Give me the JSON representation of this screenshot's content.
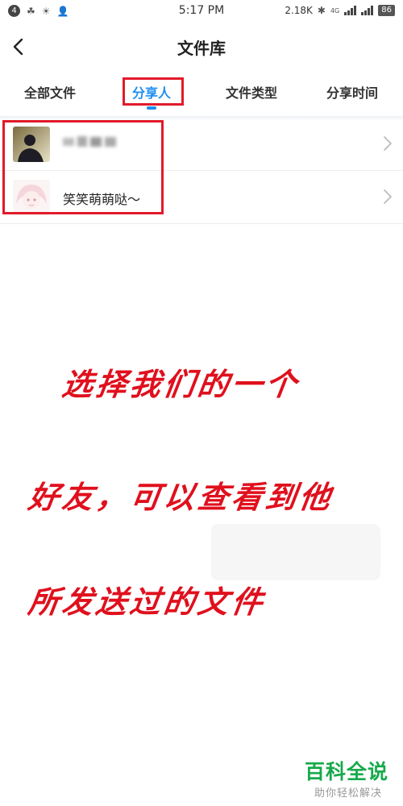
{
  "status_bar": {
    "notification_count": "4",
    "time": "5:17 PM",
    "network_speed": "2.18K",
    "battery": "86",
    "network_type": "4G"
  },
  "header": {
    "title": "文件库"
  },
  "tabs": [
    {
      "label": "全部文件",
      "active": false
    },
    {
      "label": "分享人",
      "active": true
    },
    {
      "label": "文件类型",
      "active": false
    },
    {
      "label": "分享时间",
      "active": false
    }
  ],
  "share_list": [
    {
      "name": "",
      "avatar": "dark-portrait-avatar",
      "blurred": true
    },
    {
      "name": "笑笑萌萌哒～",
      "avatar": "anime-girl-avatar",
      "blurred": false
    }
  ],
  "annotation": {
    "line1": "选择我们的一个",
    "line2": "好友，可以查看到他",
    "line3": "所发送过的文件"
  },
  "watermark": {
    "title": "百科全说",
    "subtitle": "助你轻松解决"
  },
  "colors": {
    "accent": "#1e8ff0",
    "highlight_box": "#e21a2a",
    "annotation_text": "#e0101d",
    "watermark": "#17a94b"
  }
}
